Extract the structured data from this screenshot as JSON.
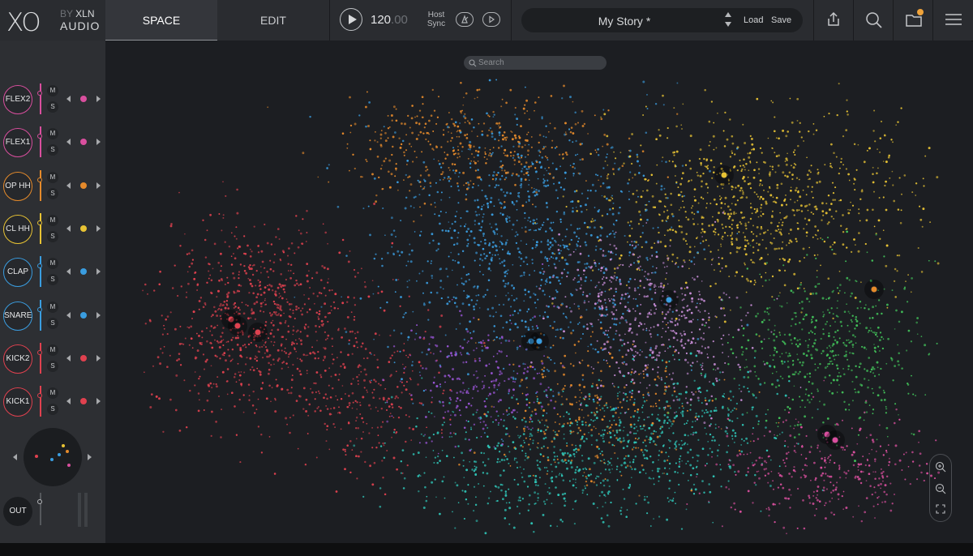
{
  "logo": {
    "mark": "XO",
    "by": "BY",
    "brand": "XLN",
    "line2": "AUDIO"
  },
  "tabs": [
    {
      "label": "SPACE",
      "active": true
    },
    {
      "label": "EDIT",
      "active": false
    }
  ],
  "transport": {
    "tempo_int": "120",
    "tempo_frac": ".00",
    "host_sync": "Host Sync"
  },
  "story": {
    "name": "My Story *",
    "load_label": "Load",
    "save_label": "Save"
  },
  "top_icons": [
    "export-icon",
    "search-icon",
    "folder-icon",
    "menu-icon"
  ],
  "folder_notification_color": "#f0a33a",
  "search": {
    "placeholder": "Search"
  },
  "tracks": [
    {
      "name": "FLEX2",
      "color": "#d94f9e",
      "mute": "M",
      "solo": "S"
    },
    {
      "name": "FLEX1",
      "color": "#d94f9e",
      "mute": "M",
      "solo": "S"
    },
    {
      "name": "OP HH",
      "color": "#e58a2b",
      "mute": "M",
      "solo": "S"
    },
    {
      "name": "CL HH",
      "color": "#e8c334",
      "mute": "M",
      "solo": "S"
    },
    {
      "name": "CLAP",
      "color": "#3a9de0",
      "mute": "M",
      "solo": "S"
    },
    {
      "name": "SNARE",
      "color": "#3a9de0",
      "mute": "M",
      "solo": "S"
    },
    {
      "name": "KICK2",
      "color": "#e0414f",
      "mute": "M",
      "solo": "S"
    },
    {
      "name": "KICK1",
      "color": "#e0414f",
      "mute": "M",
      "solo": "S"
    }
  ],
  "output": {
    "label": "OUT"
  },
  "colors": {
    "kick": "#e0414f",
    "snare": "#3a9de0",
    "hihat_open": "#e58a2b",
    "hihat_closed": "#e8c334",
    "percussion": "#2fc6b8",
    "cymbal": "#42c25a",
    "tom": "#d94f9e",
    "other": "#c98fd9",
    "purple": "#9a55d6"
  }
}
